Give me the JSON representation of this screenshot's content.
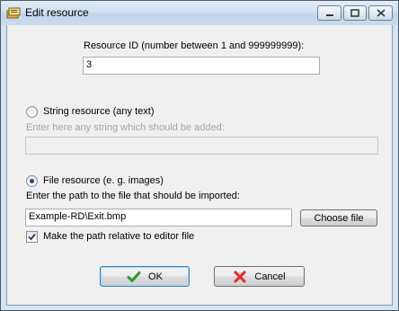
{
  "window": {
    "title": "Edit resource",
    "icon": "resource-icon"
  },
  "resource_id": {
    "label": "Resource ID (number between 1 and 999999999):",
    "value": "3"
  },
  "string_resource": {
    "label": "String resource (any text)",
    "hint": "Enter here any string which should be added:",
    "value": "",
    "selected": false
  },
  "file_resource": {
    "label": "File resource (e. g. images)",
    "hint": "Enter the path to the file that should be imported:",
    "value": "Example-RD\\Exit.bmp",
    "selected": true,
    "choose_label": "Choose file",
    "relative_label": "Make the path relative to editor file",
    "relative_checked": true
  },
  "buttons": {
    "ok_label": "OK",
    "cancel_label": "Cancel"
  },
  "colors": {
    "title_bar": "#c9dbee",
    "dialog_bg": "#f0f0f0",
    "ok_icon": "#2e9a2e",
    "cancel_icon": "#e0342b"
  }
}
